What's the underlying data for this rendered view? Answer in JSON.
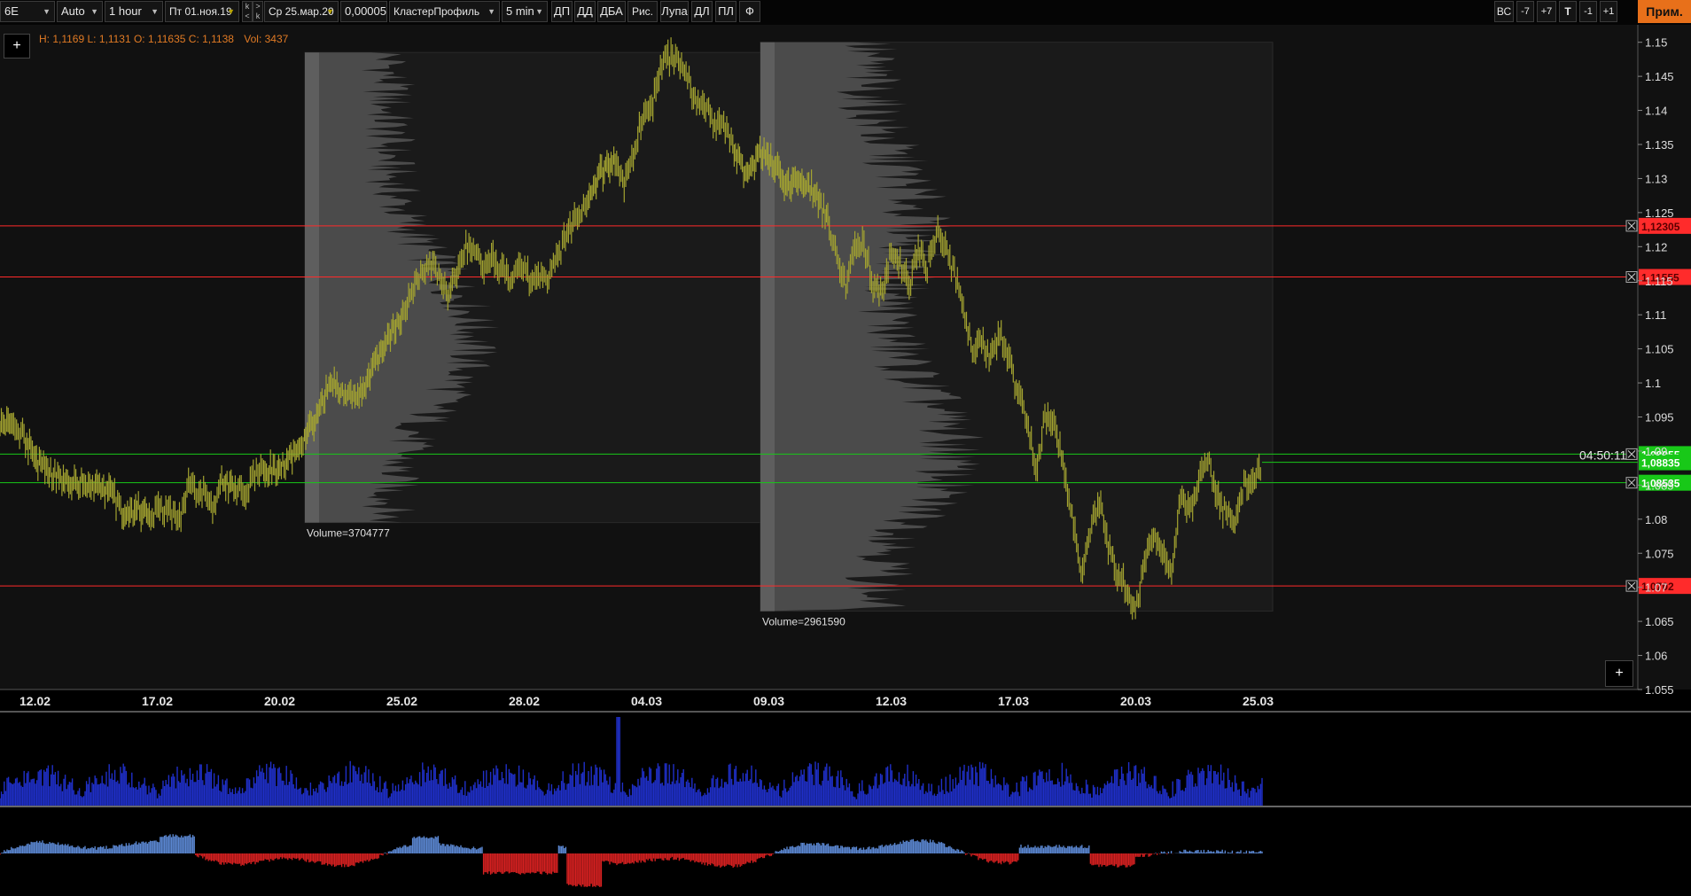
{
  "toolbar": {
    "symbol": "6E",
    "scale": "Auto",
    "timeframe": "1 hour",
    "date_from": "Пт 01.ноя.19",
    "date_to": "Ср 25.мар.20",
    "tick_size": "0,00005",
    "indicator": "КластерПрофиль",
    "profile_period": "5 min",
    "k_up": "k",
    "k_down": "k",
    "buttons": [
      "ДП",
      "ДД",
      "ДБА",
      "Рис.",
      "Лупа",
      "ДЛ",
      "ПЛ",
      "Ф"
    ],
    "right_buttons": [
      "ВС",
      "-7",
      "+7",
      "T",
      "-1",
      "+1"
    ],
    "apply_label": "Прим."
  },
  "info": {
    "ohlc": "H: 1,1169 L: 1,1131 O: 1,11635 C: 1,1138",
    "volume": "Vol: 3437"
  },
  "add_button_label": "+",
  "chart_data": {
    "type": "candlestick",
    "y_axis_ticks": [
      "1.15",
      "1.145",
      "1.14",
      "1.135",
      "1.13",
      "1.125",
      "1.12",
      "1.115",
      "1.11",
      "1.105",
      "1.1",
      "1.095",
      "1.09",
      "1.085",
      "1.08",
      "1.075",
      "1.07",
      "1.065",
      "1.06",
      "1.055"
    ],
    "ylim": [
      1.055,
      1.151
    ],
    "x_axis_ticks": [
      "12.02",
      "17.02",
      "20.02",
      "25.02",
      "28.02",
      "04.03",
      "09.03",
      "12.03",
      "17.03",
      "20.03",
      "25.03"
    ],
    "horizontal_levels": [
      {
        "label": "1,12305",
        "value": 1.12305,
        "color": "#ff2b2b"
      },
      {
        "label": "1,11555",
        "value": 1.11555,
        "color": "#ff2b2b"
      },
      {
        "label": "1,08955",
        "value": 1.08955,
        "color": "#18c818"
      },
      {
        "label": "1,08535",
        "value": 1.08535,
        "color": "#18c818"
      },
      {
        "label": "1,0702",
        "value": 1.0702,
        "color": "#ff2b2b"
      }
    ],
    "current_price": {
      "label": "1,08835",
      "value": 1.08835,
      "color": "#18c818"
    },
    "countdown": "04:50:11",
    "volume_profiles": [
      {
        "label": "Volume=3704777",
        "from": "20.02",
        "to": "09.03",
        "high": 1.1485,
        "low": 1.0795
      },
      {
        "label": "Volume=2961590",
        "from": "09.03",
        "to": "25.03",
        "high": 1.15,
        "low": 1.0665
      }
    ],
    "price_path": [
      [
        0,
        1.094
      ],
      [
        6,
        1.094
      ],
      [
        10,
        1.092
      ],
      [
        18,
        1.088
      ],
      [
        28,
        1.0855
      ],
      [
        36,
        1.0855
      ],
      [
        44,
        1.0845
      ],
      [
        50,
        1.0835
      ],
      [
        54,
        1.081
      ],
      [
        60,
        1.0815
      ],
      [
        66,
        1.0805
      ],
      [
        70,
        1.0815
      ],
      [
        74,
        1.081
      ],
      [
        78,
        1.0805
      ],
      [
        80,
        1.08
      ],
      [
        82,
        1.083
      ],
      [
        84,
        1.0855
      ],
      [
        86,
        1.0845
      ],
      [
        90,
        1.0835
      ],
      [
        94,
        1.082
      ],
      [
        98,
        1.0855
      ],
      [
        104,
        1.085
      ],
      [
        108,
        1.0835
      ],
      [
        112,
        1.0865
      ],
      [
        116,
        1.087
      ],
      [
        122,
        1.0875
      ],
      [
        128,
        1.089
      ],
      [
        134,
        1.091
      ],
      [
        140,
        1.095
      ],
      [
        146,
        1.1
      ],
      [
        152,
        1.099
      ],
      [
        160,
        1.098
      ],
      [
        166,
        1.103
      ],
      [
        172,
        1.107
      ],
      [
        178,
        1.11
      ],
      [
        182,
        1.113
      ],
      [
        186,
        1.1165
      ],
      [
        190,
        1.118
      ],
      [
        194,
        1.1155
      ],
      [
        198,
        1.1135
      ],
      [
        202,
        1.116
      ],
      [
        206,
        1.12
      ],
      [
        210,
        1.119
      ],
      [
        214,
        1.1165
      ],
      [
        218,
        1.118
      ],
      [
        222,
        1.1165
      ],
      [
        226,
        1.1145
      ],
      [
        230,
        1.117
      ],
      [
        234,
        1.1155
      ],
      [
        238,
        1.116
      ],
      [
        242,
        1.115
      ],
      [
        244,
        1.117
      ],
      [
        248,
        1.1195
      ],
      [
        252,
        1.1225
      ],
      [
        256,
        1.125
      ],
      [
        260,
        1.127
      ],
      [
        266,
        1.131
      ],
      [
        272,
        1.133
      ],
      [
        276,
        1.129
      ],
      [
        280,
        1.133
      ],
      [
        284,
        1.139
      ],
      [
        288,
        1.14
      ],
      [
        292,
        1.146
      ],
      [
        296,
        1.148
      ],
      [
        300,
        1.147
      ],
      [
        304,
        1.145
      ],
      [
        308,
        1.141
      ],
      [
        312,
        1.141
      ],
      [
        316,
        1.138
      ],
      [
        320,
        1.138
      ],
      [
        324,
        1.135
      ],
      [
        330,
        1.13
      ],
      [
        336,
        1.134
      ],
      [
        342,
        1.132
      ],
      [
        348,
        1.129
      ],
      [
        354,
        1.13
      ],
      [
        360,
        1.128
      ],
      [
        366,
        1.124
      ],
      [
        370,
        1.118
      ],
      [
        374,
        1.114
      ],
      [
        378,
        1.12
      ],
      [
        382,
        1.121
      ],
      [
        386,
        1.114
      ],
      [
        390,
        1.113
      ],
      [
        394,
        1.119
      ],
      [
        398,
        1.118
      ],
      [
        402,
        1.114
      ],
      [
        406,
        1.12
      ],
      [
        410,
        1.117
      ],
      [
        414,
        1.122
      ],
      [
        418,
        1.12
      ],
      [
        422,
        1.116
      ],
      [
        426,
        1.111
      ],
      [
        430,
        1.104
      ],
      [
        434,
        1.106
      ],
      [
        438,
        1.103
      ],
      [
        442,
        1.107
      ],
      [
        446,
        1.104
      ],
      [
        450,
        1.098
      ],
      [
        454,
        1.095
      ],
      [
        458,
        1.087
      ],
      [
        462,
        1.095
      ],
      [
        466,
        1.094
      ],
      [
        470,
        1.088
      ],
      [
        474,
        1.081
      ],
      [
        478,
        1.072
      ],
      [
        482,
        1.078
      ],
      [
        486,
        1.083
      ],
      [
        490,
        1.076
      ],
      [
        494,
        1.072
      ],
      [
        498,
        1.07
      ],
      [
        502,
        1.066
      ],
      [
        506,
        1.074
      ],
      [
        510,
        1.078
      ],
      [
        514,
        1.075
      ],
      [
        518,
        1.072
      ],
      [
        522,
        1.083
      ],
      [
        526,
        1.081
      ],
      [
        530,
        1.085
      ],
      [
        534,
        1.089
      ],
      [
        538,
        1.083
      ],
      [
        542,
        1.081
      ],
      [
        546,
        1.079
      ],
      [
        550,
        1.085
      ],
      [
        554,
        1.0855
      ],
      [
        558,
        1.088
      ]
    ],
    "volume_panel": {
      "color": "#1f2fc8"
    },
    "delta_panel": {
      "positive_color": "#5a86d0",
      "negative_color": "#d42020"
    }
  }
}
